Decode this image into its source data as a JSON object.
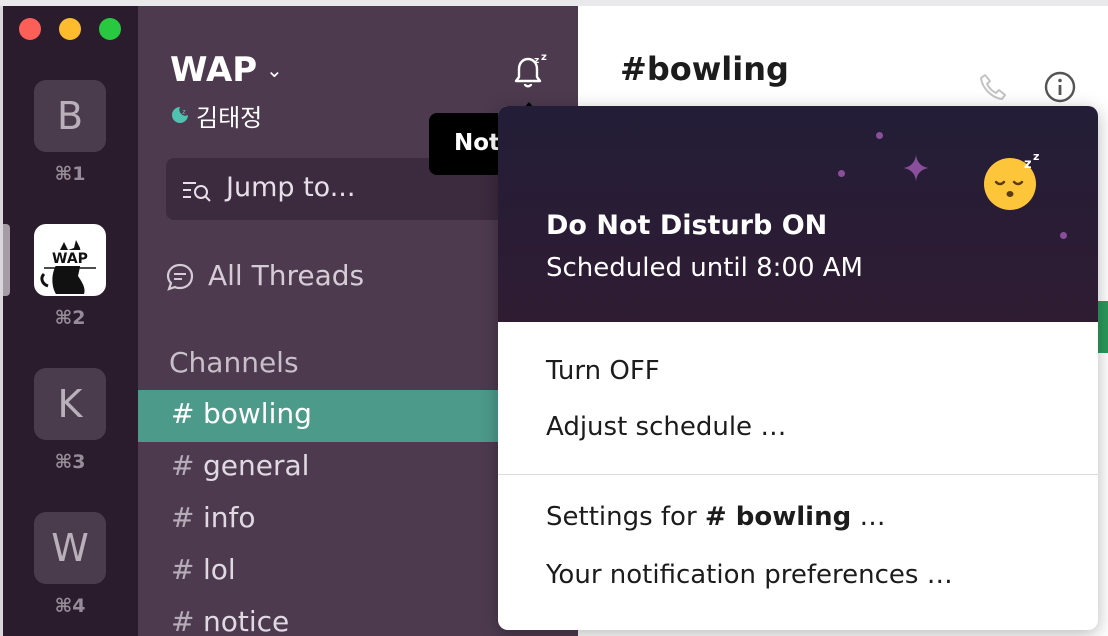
{
  "workspaces": [
    {
      "initial": "B",
      "shortcut": "⌘1"
    },
    {
      "initial": "",
      "logo_text": "WAP",
      "shortcut": "⌘2"
    },
    {
      "initial": "K",
      "shortcut": "⌘3"
    },
    {
      "initial": "W",
      "shortcut": "⌘4"
    }
  ],
  "sidebar": {
    "workspace_name": "WAP",
    "user_name": "김태정",
    "jump_placeholder": "Jump to...",
    "all_threads": "All Threads",
    "channels_header": "Channels",
    "channels": [
      "bowling",
      "general",
      "info",
      "lol",
      "notice"
    ],
    "active_channel": "bowling"
  },
  "main": {
    "channel_title": "#bowling"
  },
  "tooltip": {
    "text": "Notifications"
  },
  "dnd_popover": {
    "title": "Do Not Disturb ON",
    "subtitle": "Scheduled until 8:00 AM",
    "turn_off": "Turn OFF",
    "adjust": "Adjust schedule …",
    "settings_prefix": "Settings for ",
    "settings_channel": "# bowling",
    "settings_suffix": " …",
    "preferences": "Your notification preferences …"
  },
  "colors": {
    "rail_bg": "#2b1c2d",
    "sidebar_bg": "#4d3a4f",
    "active_channel_bg": "#4c9a8a",
    "dnd_header_bg": "#2f1c33"
  }
}
